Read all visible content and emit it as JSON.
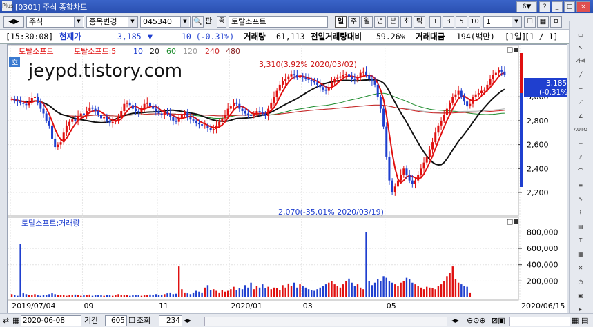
{
  "title": "[0301] 주식 종합차트",
  "window_controls": {
    "number": "6",
    "arrow": "▼",
    "qmark": "?",
    "min": "_",
    "restore": "□",
    "close": "×"
  },
  "toolbar": {
    "market": "주식",
    "mode": "종목변경",
    "code": "045340",
    "pan_label": "판",
    "pan2_label": "종",
    "stock_name": "토탈소프트",
    "periods": [
      "일",
      "주",
      "월",
      "년",
      "분",
      "초",
      "틱"
    ],
    "active_period": "일",
    "numbers": [
      "1",
      "3",
      "5",
      "10"
    ],
    "interval": "1"
  },
  "quote": {
    "time": "[15:30:08]",
    "price_label": "현재가",
    "price": "3,185",
    "arrow": "▼",
    "change": "10 (-0.31%)",
    "volume_label": "거래량",
    "volume": "61,113",
    "prev_volume_label": "전일거래량대비",
    "prev_volume_ratio": "59.26%",
    "amount_label": "거래대금",
    "amount": "194(백만)",
    "period_tag": "[1일]",
    "page": "[1 / 1]"
  },
  "watermark": "jeypd.tistory.com",
  "price_legend": {
    "name": "토탈소프트",
    "ma_name": "토탈소프트:5",
    "mas": [
      {
        "label": "10",
        "color": "#1f3fcf"
      },
      {
        "label": "20",
        "color": "#111111"
      },
      {
        "label": "60",
        "color": "#1a8a2a"
      },
      {
        "label": "120",
        "color": "#aaaaaa"
      },
      {
        "label": "240",
        "color": "#cc2222"
      },
      {
        "label": "480",
        "color": "#882222"
      }
    ],
    "side_label": "호"
  },
  "volume_legend": {
    "name": "토탈소프트:거래량"
  },
  "annotations": {
    "high": "3,310(3.92% 2020/03/02)",
    "low": "2,070(-35.01% 2020/03/19)",
    "last_price": "3,185",
    "last_change": "(-0.31%)"
  },
  "price_axis": [
    "3,000",
    "2,800",
    "2,600",
    "2,400",
    "2,200"
  ],
  "volume_axis": [
    "800,000",
    "600,000",
    "400,000",
    "200,000"
  ],
  "date_axis": [
    "2019/07/04",
    "09",
    "11",
    "2020/01",
    "03",
    "05",
    "2020/06/15"
  ],
  "bottom": {
    "date": "2020-06-08",
    "period_label": "기간",
    "period_value": "605",
    "lookup_label": "조회",
    "lookup_value": "234"
  },
  "sidebar_icons": [
    "가격",
    "AUTO"
  ],
  "chart_data": {
    "type": "candlestick",
    "ylim": [
      2070,
      3310
    ],
    "x_range": [
      "2019/07/04",
      "2020/06/15"
    ],
    "price_path": [
      2980,
      2970,
      2960,
      2950,
      2940,
      2930,
      2960,
      2990,
      3000,
      2950,
      2900,
      2860,
      2800,
      2760,
      2650,
      2580,
      2600,
      2620,
      2700,
      2760,
      2790,
      2810,
      2800,
      2840,
      2860,
      2850,
      2880,
      2910,
      2900,
      2880,
      2850,
      2820,
      2830,
      2800,
      2780,
      2790,
      2800,
      2830,
      2880,
      2940,
      2950,
      2930,
      2900,
      2880,
      2870,
      2900,
      2940,
      2950,
      2920,
      2900,
      2880,
      2860,
      2850,
      2870,
      2860,
      2830,
      2800,
      2790,
      2820,
      2850,
      2870,
      2830,
      2810,
      2800,
      2780,
      2770,
      2760,
      2760,
      2740,
      2720,
      2730,
      2760,
      2790,
      2820,
      2850,
      2900,
      2920,
      2950,
      2940,
      2900,
      2880,
      2860,
      2850,
      2840,
      2860,
      2880,
      2870,
      2860,
      2840,
      2900,
      2950,
      3000,
      3050,
      3100,
      3130,
      3150,
      3170,
      3190,
      3180,
      3160,
      3170,
      3160,
      3150,
      3140,
      3130,
      3120,
      3100,
      3080,
      3060,
      3050,
      3080,
      3120,
      3150,
      3160,
      3170,
      3180,
      3190,
      3170,
      3150,
      3140,
      3160,
      3200,
      3210,
      3180,
      3150,
      3130,
      3100,
      3000,
      2900,
      2750,
      2500,
      2300,
      2200,
      2250,
      2300,
      2350,
      2400,
      2350,
      2300,
      2270,
      2300,
      2350,
      2400,
      2450,
      2500,
      2560,
      2620,
      2700,
      2760,
      2800,
      2850,
      2900,
      2950,
      3000,
      3020,
      3050,
      3000,
      2960,
      2920,
      2940,
      3000,
      3020,
      3030,
      3050,
      3060,
      3100,
      3150,
      3180,
      3200,
      3220,
      3210,
      3185
    ],
    "volume": [
      40000,
      30000,
      20000,
      660000,
      50000,
      40000,
      30000,
      30000,
      40000,
      25000,
      20000,
      30000,
      30000,
      40000,
      50000,
      40000,
      30000,
      25000,
      30000,
      20000,
      30000,
      25000,
      35000,
      30000,
      20000,
      25000,
      30000,
      35000,
      20000,
      30000,
      30000,
      25000,
      20000,
      30000,
      25000,
      20000,
      30000,
      40000,
      30000,
      25000,
      30000,
      20000,
      25000,
      30000,
      30000,
      20000,
      25000,
      30000,
      35000,
      30000,
      40000,
      30000,
      25000,
      40000,
      50000,
      60000,
      40000,
      45000,
      380000,
      100000,
      60000,
      50000,
      40000,
      60000,
      80000,
      70000,
      60000,
      120000,
      150000,
      90000,
      100000,
      80000,
      60000,
      90000,
      70000,
      80000,
      100000,
      130000,
      90000,
      110000,
      100000,
      150000,
      120000,
      180000,
      100000,
      140000,
      120000,
      160000,
      110000,
      130000,
      100000,
      120000,
      110000,
      90000,
      150000,
      120000,
      170000,
      140000,
      180000,
      120000,
      160000,
      140000,
      120000,
      100000,
      90000,
      80000,
      100000,
      120000,
      140000,
      160000,
      180000,
      200000,
      160000,
      140000,
      120000,
      160000,
      200000,
      230000,
      180000,
      140000,
      160000,
      120000,
      100000,
      800000,
      200000,
      150000,
      180000,
      220000,
      200000,
      260000,
      240000,
      200000,
      180000,
      160000,
      140000,
      180000,
      200000,
      240000,
      220000,
      180000,
      160000,
      140000,
      120000,
      100000,
      130000,
      120000,
      110000,
      100000,
      140000,
      160000,
      200000,
      260000,
      300000,
      380000,
      220000,
      180000,
      160000,
      140000,
      130000,
      60000
    ],
    "colors": {
      "up": "#e01010",
      "down": "#1f3fcf",
      "ma20": "#111111",
      "ma60": "#1a8a2a",
      "ma120": "#aaaaaa",
      "ma240": "#cc2222"
    }
  }
}
